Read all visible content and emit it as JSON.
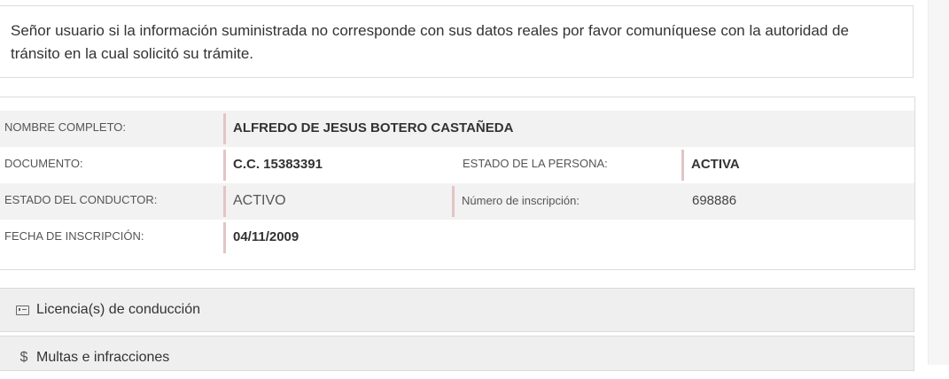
{
  "notice": {
    "text": "Señor usuario si la información suministrada no corresponde con sus datos reales por favor comuníquese con la autoridad de tránsito en la cual solicitó su trámite."
  },
  "person": {
    "full_name_label": "NOMBRE COMPLETO:",
    "full_name": "ALFREDO DE JESUS BOTERO CASTAÑEDA",
    "document_label": "DOCUMENTO:",
    "document": "C.C. 15383391",
    "person_status_label": "ESTADO DE LA PERSONA:",
    "person_status": "ACTIVA",
    "driver_status_label": "ESTADO DEL CONDUCTOR:",
    "driver_status": "ACTIVO",
    "registration_number_label": "Número de inscripción:",
    "registration_number": "698886",
    "registration_date_label": "FECHA DE INSCRIPCIÓN:",
    "registration_date": "04/11/2009"
  },
  "accordions": [
    {
      "label": "Licencia(s) de conducción",
      "icon": "id-card-icon"
    },
    {
      "label": "Multas e infracciones",
      "icon": "dollar-icon",
      "icon_glyph": "$"
    }
  ]
}
